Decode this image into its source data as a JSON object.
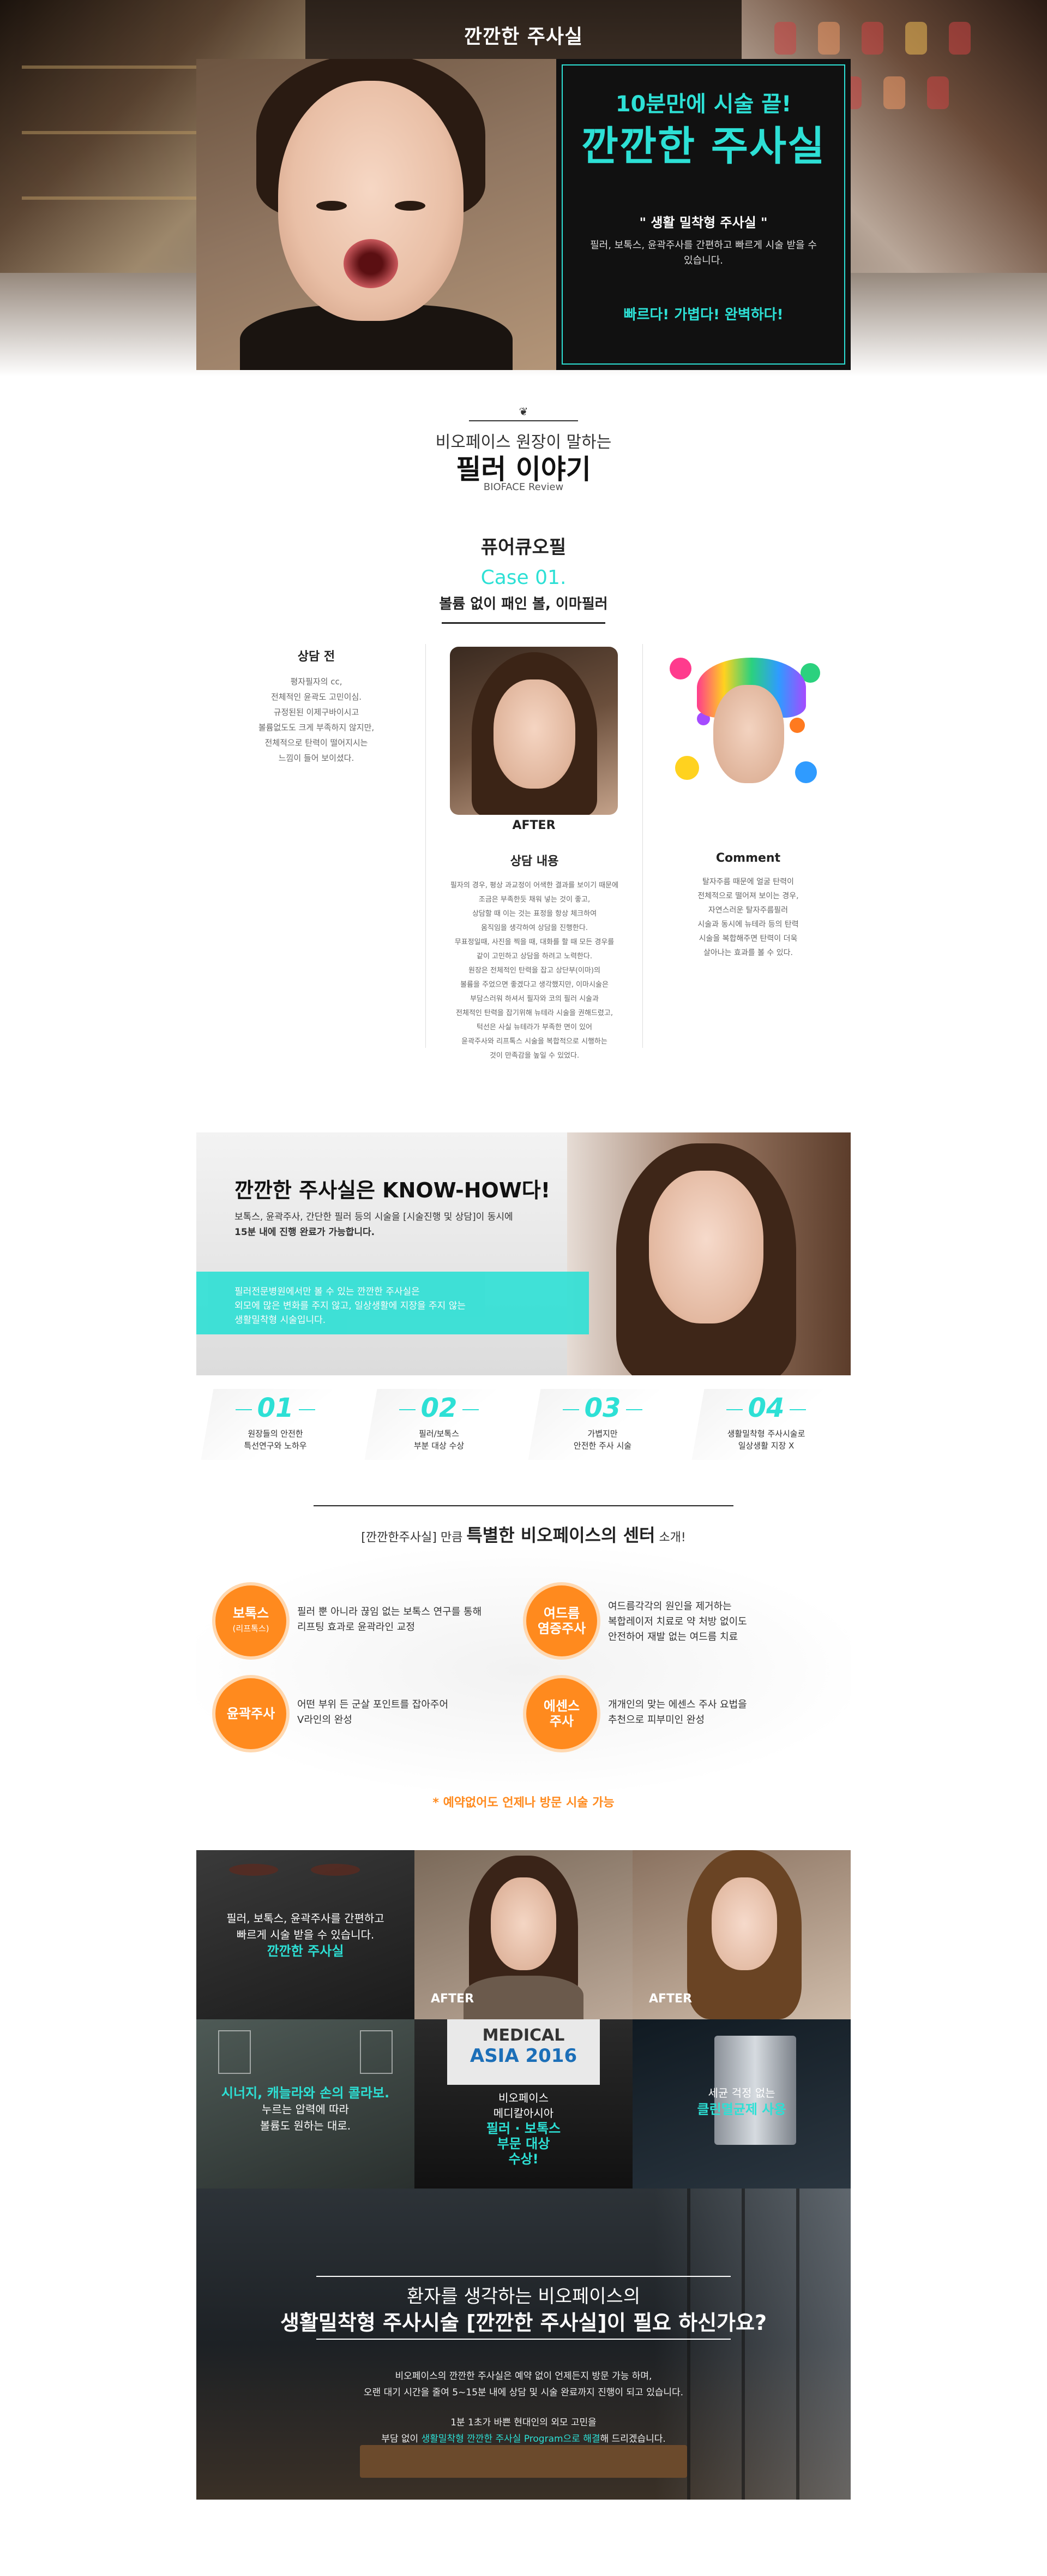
{
  "hero": {
    "top_title": "깐깐한 주사실",
    "box_line1": "10분만에 시술 끝!",
    "box_line2": "깐깐한 주사실",
    "box_line3": "\" 생활 밀착형 주사실 \"",
    "box_line4": "필러, 보톡스, 윤곽주사를 간편하고 빠르게 시술 받을 수 있습니다.",
    "box_line5": "빠르다! 가볍다! 완벽하다!"
  },
  "review": {
    "subtitle": "비오페이스 원장이 말하는",
    "title": "필러 이야기",
    "en": "BIOFACE Review",
    "profile_title": "퓨어큐오필",
    "case_no": "Case 01.",
    "case_desc": "볼륨 없이 패인 볼, 이마필러"
  },
  "before": {
    "heading": "상담 전",
    "lines": [
      "평자필자의 cc,",
      "전체적인 윤곽도 고민이심.",
      "규정된된 이제구바이시고",
      "볼륨없도도 크게 부족하지 않지만,",
      "전체적으로 탄력이 떨어지시는",
      "느낌이 들어 보이셨다."
    ]
  },
  "after": {
    "label": "AFTER",
    "heading": "상담 내용",
    "lines": [
      "필자의 경우, 평상 과교정이 어색한 결과를 보이기 때문에",
      "조금은 부족한듯 채워 넣는 것이 좋고,",
      "상담할 때 이는 것는 표정을 항상 체크하여",
      "움직임을 생각하여 상담을 진행한다.",
      "무표정일때, 사진을 찍을 때, 대화를 할 때 모든 경우를",
      "같이 고민하고 상담을 하려고 노력한다.",
      "원장은 전체적인 탄력을 잡고 상단부(이마)의",
      "볼륨을 주었으면 좋겠다고 생각했지만, 이마시술은",
      "부담스러워 하셔서 필자와 코의 필러 시술과",
      "전체적인 탄력을 잡기위해 뉴테라 시술을 권해드렸고,",
      "턱선은 사실 뉴테라가 부족한 면이 있어",
      "윤곽주사와 리프톡스 시술을 복합적으로 시행하는",
      "것이 만족감을 높일 수 있었다."
    ]
  },
  "comment": {
    "heading": "Comment",
    "lines": [
      "탈자주름 때문에 얼굴 탄력이",
      "전체적으로 떨어져 보이는 경우,",
      "자연스러운 탈자주름필러",
      "시술과 동시에 뉴테라 등의 탄력",
      "시술을 복합해주면 탄력이 더욱",
      "살아나는 효과를 볼 수 있다."
    ]
  },
  "knowhow": {
    "title": "깐깐한 주사실은 KNOW-HOW다!",
    "line1": "보톡스, 윤곽주사, 간단한 필러 등의 시술을 [시술진행 및 상담]이 동시에",
    "line2": "15분 내에 진행 완료가 가능합니다.",
    "band1": "필러전문병원에서만 볼 수 있는 깐깐한 주사실은",
    "band2": "외모에 많은 변화를 주지 않고, 일상생활에 지장을 주지 않는",
    "band3": "생활밀착형 시술입니다."
  },
  "steps": [
    {
      "num": "01",
      "l1": "원장들의 안전한",
      "l2": "특선연구와 노하우"
    },
    {
      "num": "02",
      "l1": "필러/보톡스",
      "l2": "부분 대상 수상"
    },
    {
      "num": "03",
      "l1": "가볍지만",
      "l2": "안전한 주사 시술"
    },
    {
      "num": "04",
      "l1": "생활밀착형 주사시술로",
      "l2": "일상생활 지장 X"
    }
  ],
  "center": {
    "pre": "[깐깐한주사실] 만큼 ",
    "big": "특별한 비오페이스의 센터",
    "post": " 소개!",
    "items": [
      {
        "name": "보톡스",
        "sub": "(리프톡스)",
        "d1": "필러 뿐 아니라 끊임 없는 보톡스 연구를 통해",
        "d2": "리프팅 효과로 윤곽라인 교정"
      },
      {
        "name": "여드름\n염증주사",
        "sub": "",
        "d1": "여드름각각의 원인을 제거하는",
        "d2": "복합레이저 치료로 약 처방 없이도",
        "d3": "안전하어 재발 없는 여드름 치료"
      },
      {
        "name": "윤곽주사",
        "sub": "",
        "d1": "어떤 부위 든 군살 포인트를 잡아주어",
        "d2": "V라인의 완성"
      },
      {
        "name": "에센스\n주사",
        "sub": "",
        "d1": "개개인의 맞는 에센스 주사 요법을",
        "d2": "추천으로 피부미인 완성"
      }
    ],
    "notice": "* 예약없어도 언제나 방문 시술 가능"
  },
  "gallery": {
    "c1_l1": "필러, 보톡스, 윤곽주사를 간편하고",
    "c1_l2": "빠르게 시술 받을 수 있습니다.",
    "c1_hl": "깐깐한 주사실",
    "after1": "AFTER",
    "after2": "AFTER",
    "c4_hl": "시너지, 캐늘라와 손의 콜라보.",
    "c4_l1": "누르는 압력에 따라",
    "c4_l2": "볼륨도 원하는 대로.",
    "c5_l1": "비오페이스",
    "c5_l2": "메디칼아시아",
    "c5_hl1": "필러 · 보톡스",
    "c5_hl2": "부문 대상",
    "c5_hl3": "수상!",
    "c5_banner1": "MEDICAL",
    "c5_banner2": "ASIA 2016",
    "c6_l1": "세균 걱정 없는",
    "c6_hl": "클린멸균제 사용"
  },
  "bottom": {
    "title1": "환자를 생각하는 비오페이스의",
    "title2": "생활밀착형 주사시술 [깐깐한 주사실]이 필요 하신가요?",
    "p1": "비오페이스의 깐깐한 주사실은 예약 없이 언제든지 방문 가능 하며,",
    "p2": "오랜 대기 시간을 줄여 5~15분 내에 상담 및 시술 완료까지 진행이 되고 있습니다.",
    "p3": "1분 1초가 바쁜 현대인의 외모 고민을",
    "p4_pre": "부담 없이 ",
    "p4_hl": "생활밀착형 깐깐한 주사실 Program으로 해결",
    "p4_post": "해 드리겠습니다."
  },
  "colors": {
    "accent": "#2de0d5",
    "orange": "#ff8a1e",
    "dark": "#111111"
  }
}
